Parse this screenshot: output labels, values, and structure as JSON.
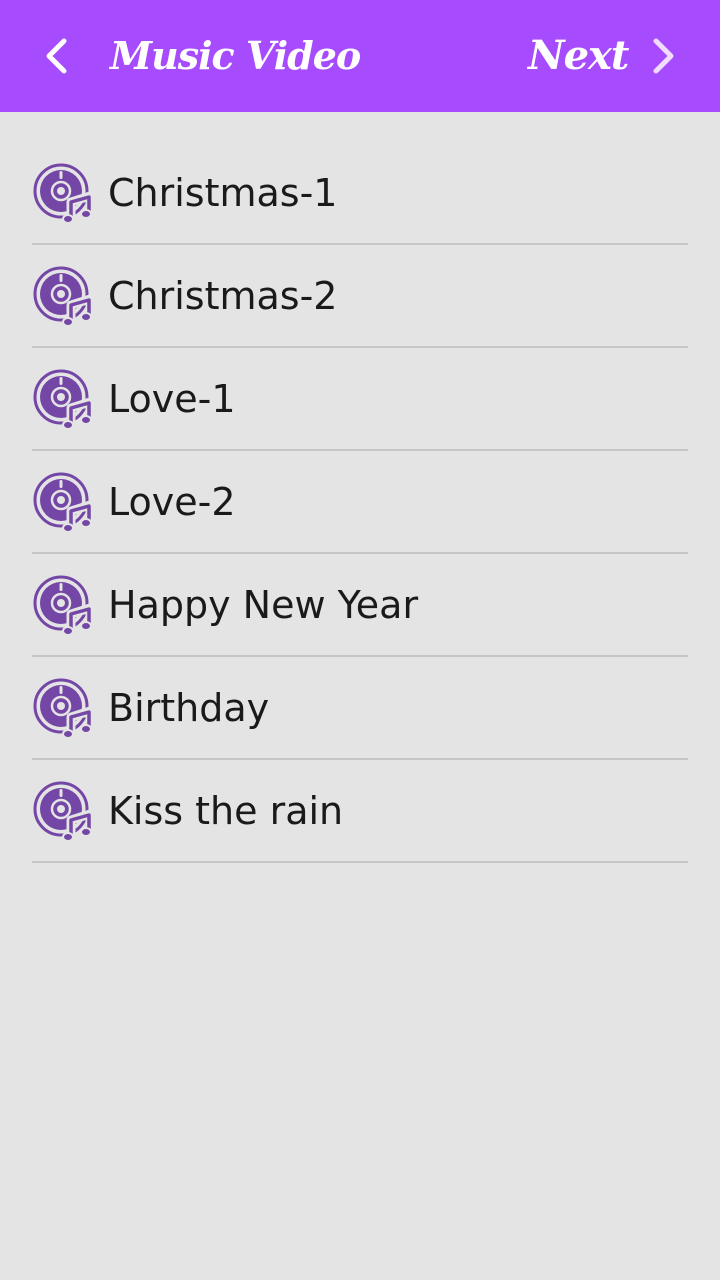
{
  "header": {
    "title": "Music Video",
    "next_label": "Next",
    "back_icon": "chevron-left-icon",
    "next_icon": "chevron-right-icon",
    "background": "#a64bfd"
  },
  "list": {
    "item_icon": "music-disc-icon",
    "icon_color": "#7446a6",
    "items": [
      {
        "label": "Christmas-1"
      },
      {
        "label": "Christmas-2"
      },
      {
        "label": "Love-1"
      },
      {
        "label": "Love-2"
      },
      {
        "label": "Happy New Year"
      },
      {
        "label": "Birthday"
      },
      {
        "label": "Kiss the rain"
      }
    ]
  }
}
